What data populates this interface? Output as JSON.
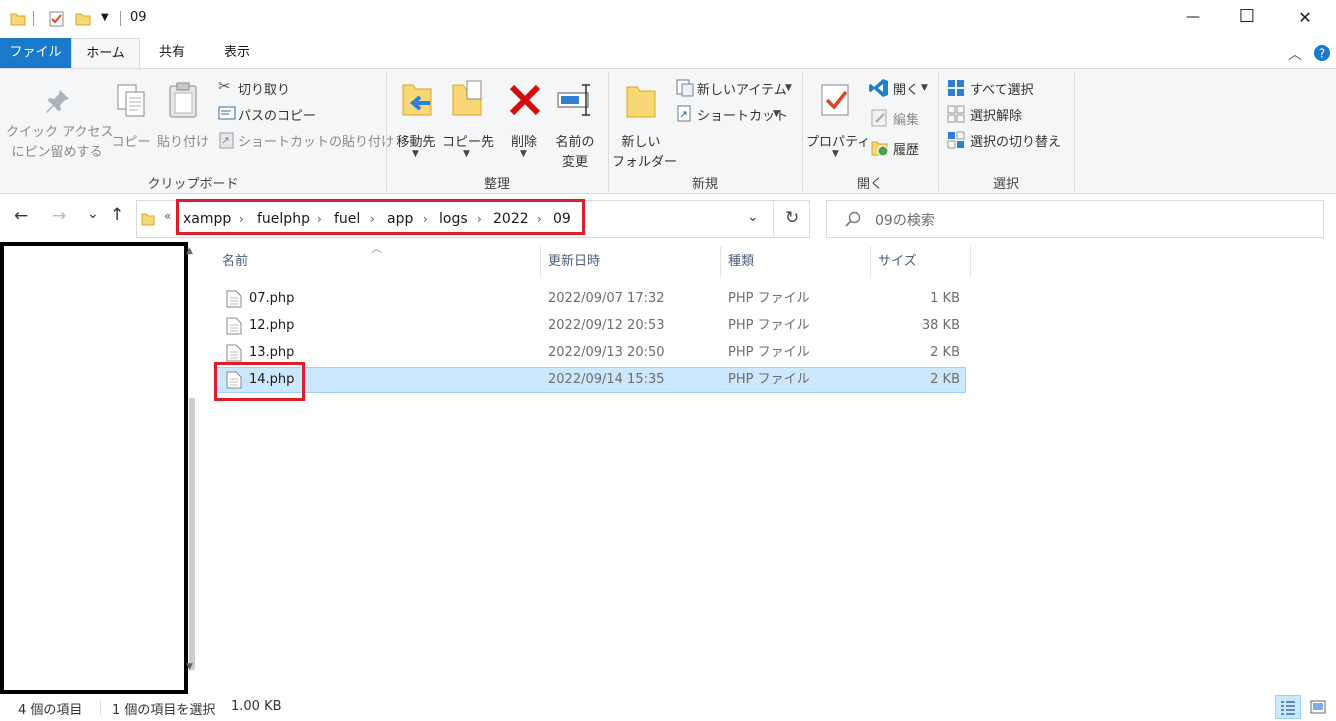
{
  "title_bar": {
    "window_title": "09",
    "minimize_symbol": "—",
    "maximize_symbol": "☐",
    "close_symbol": "✕"
  },
  "tabs": [
    {
      "label": "ファイル",
      "active": true
    },
    {
      "label": "ホーム"
    },
    {
      "label": "共有"
    },
    {
      "label": "表示"
    }
  ],
  "ribbon": {
    "clipboard": {
      "pin_label_1": "クイック アクセス",
      "pin_label_2": "にピン留めする",
      "copy_label": "コピー",
      "paste_label": "貼り付け",
      "cut_label": "切り取り",
      "copy_path_label": "パスのコピー",
      "paste_shortcut_label": "ショートカットの貼り付け",
      "group_label": "クリップボード"
    },
    "organize": {
      "move_to_label": "移動先",
      "copy_to_label": "コピー先",
      "delete_label": "削除",
      "rename_label_1": "名前の",
      "rename_label_2": "変更",
      "group_label": "整理"
    },
    "new": {
      "new_folder_label_1": "新しい",
      "new_folder_label_2": "フォルダー",
      "new_item_label": "新しいアイテム",
      "shortcut_label": "ショートカット",
      "group_label": "新規"
    },
    "open": {
      "properties_label": "プロパティ",
      "open_label": "開く",
      "edit_label": "編集",
      "history_label": "履歴",
      "group_label": "開く"
    },
    "select": {
      "select_all_label": "すべて選択",
      "select_none_label": "選択解除",
      "invert_label": "選択の切り替え",
      "group_label": "選択"
    }
  },
  "address": {
    "overflow": "«",
    "crumbs": [
      "xampp",
      "fuelphp",
      "fuel",
      "app",
      "logs",
      "2022",
      "09"
    ],
    "search_placeholder": "09の検索"
  },
  "columns": {
    "name": "名前",
    "modified": "更新日時",
    "type": "種類",
    "size": "サイズ"
  },
  "files": [
    {
      "name": "07.php",
      "modified": "2022/09/07 17:32",
      "type": "PHP ファイル",
      "size": "1 KB"
    },
    {
      "name": "12.php",
      "modified": "2022/09/12 20:53",
      "type": "PHP ファイル",
      "size": "38 KB"
    },
    {
      "name": "13.php",
      "modified": "2022/09/13 20:50",
      "type": "PHP ファイル",
      "size": "2 KB"
    },
    {
      "name": "14.php",
      "modified": "2022/09/14 15:35",
      "type": "PHP ファイル",
      "size": "2 KB",
      "selected": true
    }
  ],
  "status": {
    "item_count": "4 個の項目",
    "selection": "1 個の項目を選択",
    "selection_size": "1.00 KB"
  },
  "colors": {
    "file_tab": "#1979ca",
    "selection_bg": "#cce8ff",
    "highlight_red": "#e01e2b",
    "delete_red": "#d20f0f"
  }
}
